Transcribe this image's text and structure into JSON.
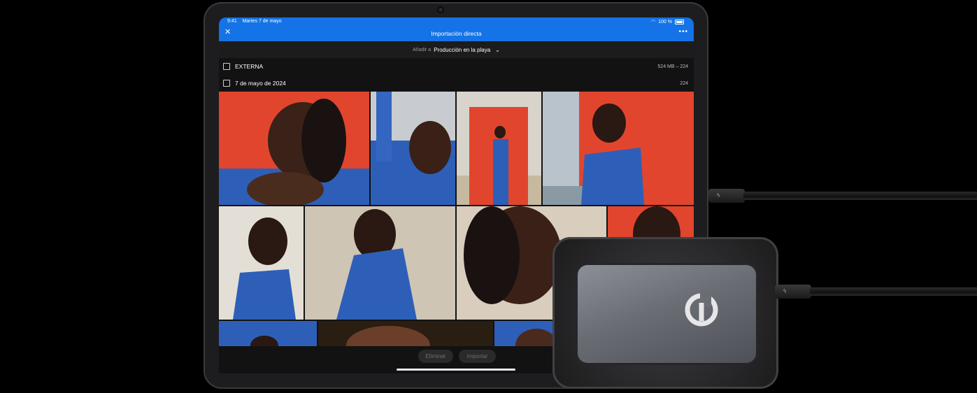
{
  "status_bar": {
    "time": "9:41",
    "date": "Martes 7 de mayo",
    "battery": "100 %"
  },
  "header": {
    "title": "Importación directa",
    "close_icon": "close-icon",
    "more_icon": "more-icon"
  },
  "add_to": {
    "label": "Añadir a",
    "album": "Producción en la playa"
  },
  "sources": [
    {
      "label": "EXTERNA",
      "meta": "524 MB – 224"
    },
    {
      "label": "7 de mayo de 2024",
      "meta": "224"
    }
  ],
  "actions": {
    "delete": "Eliminar",
    "import": "Importar"
  },
  "colors": {
    "accent": "#1473e6",
    "backdrop_red": "#e2452e",
    "shirt_blue": "#2e5fb8"
  }
}
